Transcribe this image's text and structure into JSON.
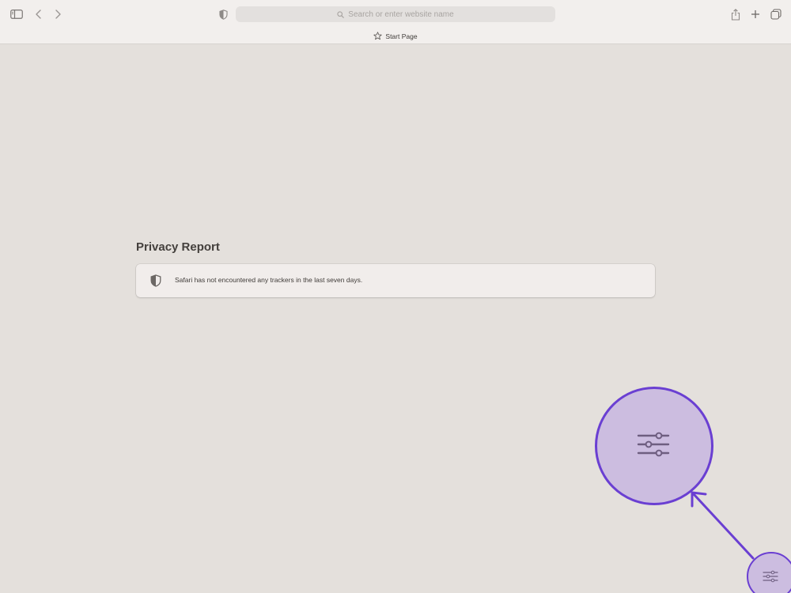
{
  "toolbar": {
    "sidebar_icon": "sidebar-icon",
    "back_icon": "chevron-left-icon",
    "forward_icon": "chevron-right-icon",
    "privacy_icon": "shield-icon",
    "search_icon": "search-icon",
    "address_placeholder": "Search or enter website name",
    "share_icon": "share-icon",
    "new_tab_icon": "plus-icon",
    "tab_overview_icon": "tab-overview-icon"
  },
  "tab": {
    "icon": "star-icon",
    "label": "Start Page"
  },
  "privacy_report": {
    "title": "Privacy Report",
    "icon": "shield-icon",
    "message": "Safari has not encountered any trackers in the last seven days."
  },
  "callout": {
    "icon": "sliders-icon",
    "accent_color": "#6a3fd2",
    "fill_color": "#ccbde0"
  }
}
